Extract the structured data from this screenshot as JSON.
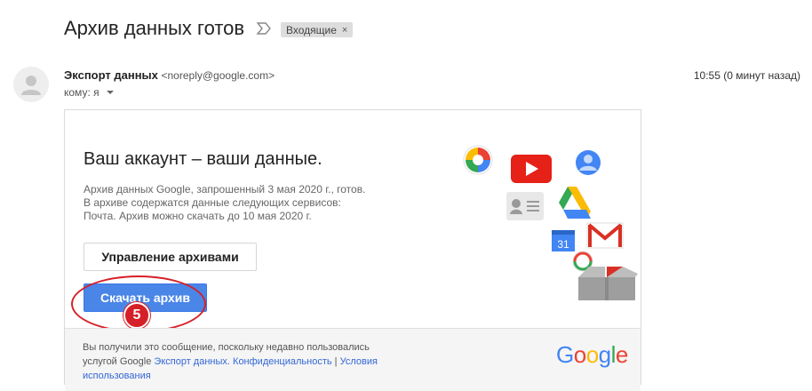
{
  "header": {
    "subject": "Архив данных готов",
    "label": "Входящие",
    "label_close": "×"
  },
  "message": {
    "sender_name": "Экспорт данных",
    "sender_email": "<noreply@google.com>",
    "to_line": "кому: я",
    "time": "10:55 (0 минут назад)"
  },
  "card": {
    "title": "Ваш аккаунт – ваши данные.",
    "body_lines": [
      "Архив данных Google, запрошенный 3 мая 2020 г., готов.",
      "В архиве содержатся данные следующих сервисов:",
      "Почта. Архив можно скачать до 10 мая 2020 г."
    ],
    "manage_label": "Управление архивами",
    "download_label": "Скачать архив",
    "calendar_day": "31"
  },
  "annotation": {
    "step": "5"
  },
  "footer": {
    "text_line1": "Вы получили это сообщение, поскольку недавно пользовались",
    "text_prefix": "услугой Google ",
    "link_export": "Экспорт данных.",
    "link_privacy": "Конфиденциальность",
    "separator": " | ",
    "link_terms": "Условия использования",
    "logo_letters": [
      "G",
      "o",
      "o",
      "g",
      "l",
      "e"
    ],
    "logo_colors": [
      "#4285F4",
      "#EA4335",
      "#FBBC05",
      "#4285F4",
      "#34A853",
      "#EA4335"
    ]
  },
  "colors": {
    "button_blue": "#4a86e8",
    "annotation_red": "#d62027",
    "link_blue": "#3367d6"
  },
  "icons": [
    "photos-icon",
    "youtube-icon",
    "profile-icon",
    "contacts-icon",
    "drive-icon",
    "calendar-icon",
    "gmail-icon",
    "hangouts-icon",
    "archive-box-icon"
  ]
}
